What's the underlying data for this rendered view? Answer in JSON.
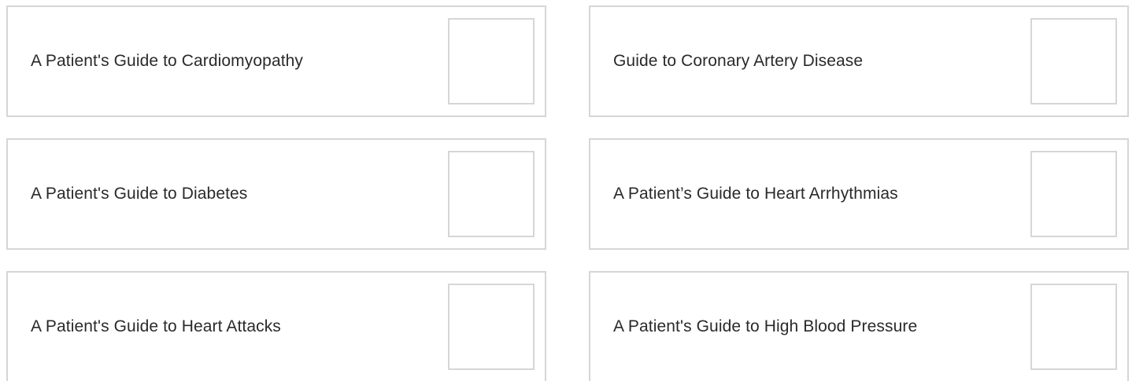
{
  "resources": {
    "items": [
      {
        "title": "A Patient's Guide to Cardiomyopathy"
      },
      {
        "title": "Guide to Coronary Artery Disease"
      },
      {
        "title": "A Patient's Guide to Diabetes"
      },
      {
        "title": "A Patient’s Guide to Heart Arrhythmias"
      },
      {
        "title": "A Patient's Guide to Heart Attacks"
      },
      {
        "title": "A Patient's Guide to High Blood Pressure"
      }
    ]
  },
  "colors": {
    "border": "#d6d6d6",
    "text": "#2a2a2a",
    "background": "#ffffff"
  }
}
